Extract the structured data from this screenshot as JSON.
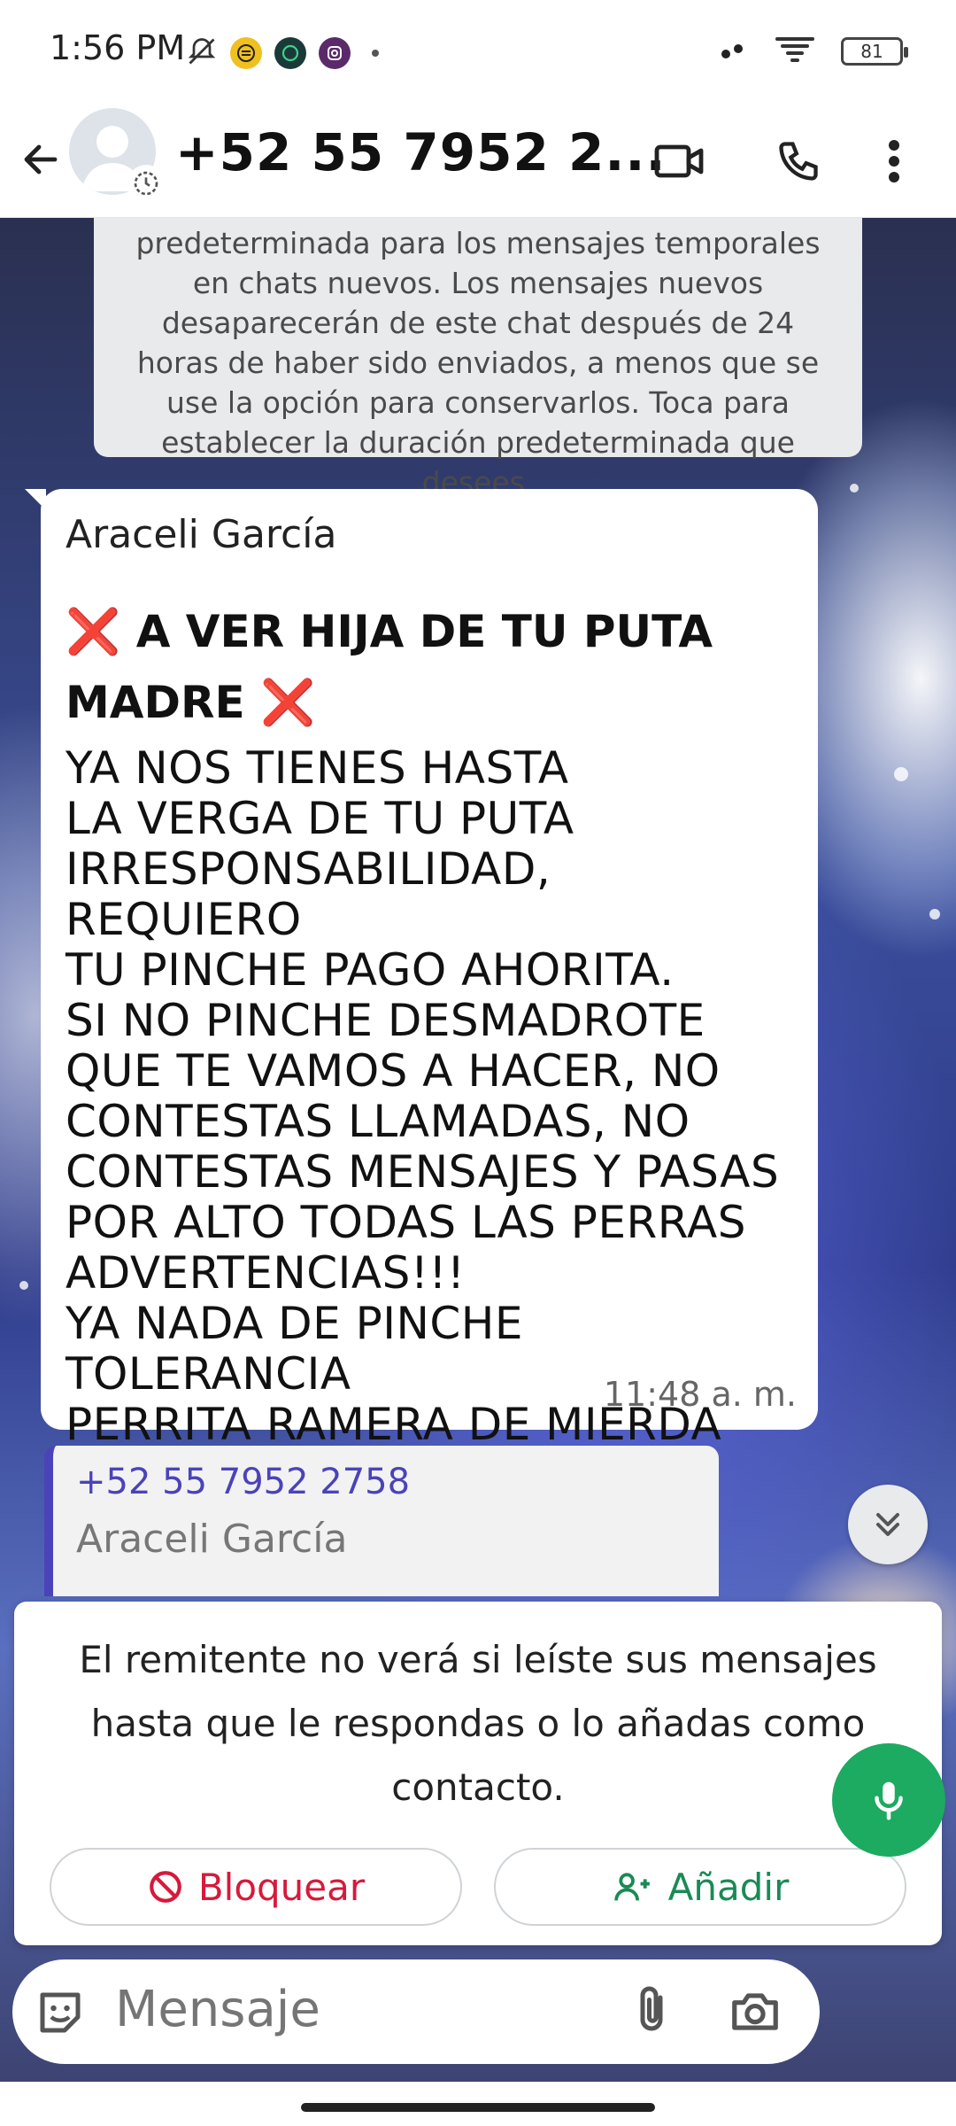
{
  "status_bar": {
    "time": "1:56 PM",
    "battery": "81",
    "icons": [
      "bell-off-icon",
      "dot-icon",
      "wifi-icon",
      "battery-icon"
    ]
  },
  "header": {
    "contact_name": "+52 55 7952 2...",
    "actions": [
      "video-call-icon",
      "phone-icon",
      "more-icon"
    ]
  },
  "system_message": {
    "text": "predeterminada para los mensajes temporales en chats nuevos. Los mensajes nuevos desaparecerán de este chat después de 24 horas de haber sido enviados, a menos que se use la opción para conservarlos. Toca para establecer la duración predeterminada que desees."
  },
  "message": {
    "sender": "Araceli García",
    "title_cross": "❌",
    "title_text": "A VER HIJA DE TU PUTA MADRE",
    "lines": [
      "YA NOS TIENES HASTA",
      "LA VERGA DE TU PUTA",
      "IRRESPONSABILIDAD, REQUIERO",
      "TU PINCHE PAGO AHORITA.",
      "SI NO PINCHE DESMADROTE",
      "QUE TE VAMOS A HACER, NO",
      "CONTESTAS LLAMADAS, NO",
      "CONTESTAS MENSAJES Y PASAS",
      "POR ALTO TODAS LAS PERRAS",
      "ADVERTENCIAS!!!",
      "YA NADA DE PINCHE TOLERANCIA",
      "PERRITA RAMERA DE MIERDA"
    ],
    "time": "11:48 a. m."
  },
  "reply_card": {
    "number": "+52 55 7952 2758",
    "name": "Araceli García"
  },
  "notice": {
    "text": "El remitente no verá si leíste sus mensajes hasta que le respondas o lo añadas como contacto.",
    "block_label": "Bloquear",
    "add_label": "Añadir"
  },
  "input": {
    "placeholder": "Mensaje"
  },
  "colors": {
    "accent_green": "#1daa61",
    "block_red": "#d7193b",
    "reply_purple": "#4b43b8"
  }
}
